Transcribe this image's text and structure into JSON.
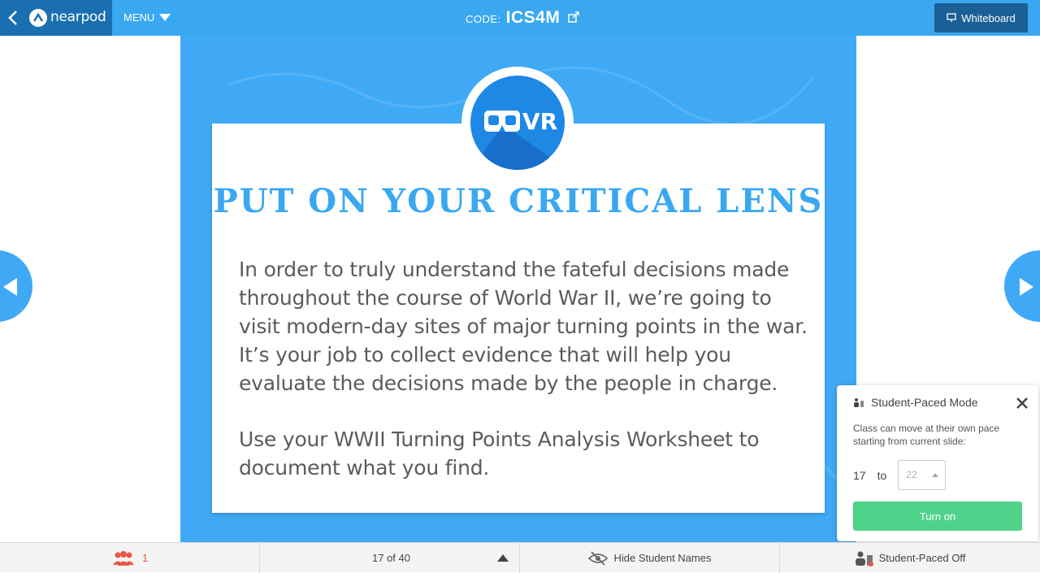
{
  "header": {
    "logo_text": "nearpod",
    "menu_label": "MENU",
    "code_label": "CODE:",
    "code_value": "ICS4M",
    "whiteboard_label": "Whiteboard"
  },
  "slide": {
    "badge_text": "VR",
    "title": "PUT ON YOUR CRITICAL LENS",
    "paragraph1": "In order to truly understand the fateful decisions made throughout the course of World War II, we’re going to visit modern-day sites of major turning points in the war. It’s your job to collect evidence that will help you evaluate the decisions made by the people in charge.",
    "paragraph2": "Use your WWII Turning Points Analysis Worksheet to document what you find."
  },
  "student_paced": {
    "title": "Student-Paced Mode",
    "description": "Class can move at their own pace starting from current slide:",
    "from_value": "17",
    "to_label": "to",
    "to_value": "22",
    "turn_on_label": "Turn on"
  },
  "footer": {
    "student_count": "1",
    "pager": "17 of 40",
    "hide_names_label": "Hide Student Names",
    "student_paced_status": "Student-Paced Off"
  },
  "colors": {
    "topbar": "#3aa8f0",
    "logo_bg": "#1a6fb0",
    "slide_bg": "#3fa9f5",
    "title": "#3aa8f0",
    "turn_on": "#4fd38a",
    "student_count": "#e8574a"
  },
  "icons": [
    "back-chevron-icon",
    "nearpod-logo-icon",
    "caret-down-icon",
    "share-icon",
    "whiteboard-icon",
    "vr-goggles-icon",
    "prev-arrow-icon",
    "next-arrow-icon",
    "student-paced-icon",
    "close-icon",
    "students-icon",
    "eye-slash-icon"
  ]
}
